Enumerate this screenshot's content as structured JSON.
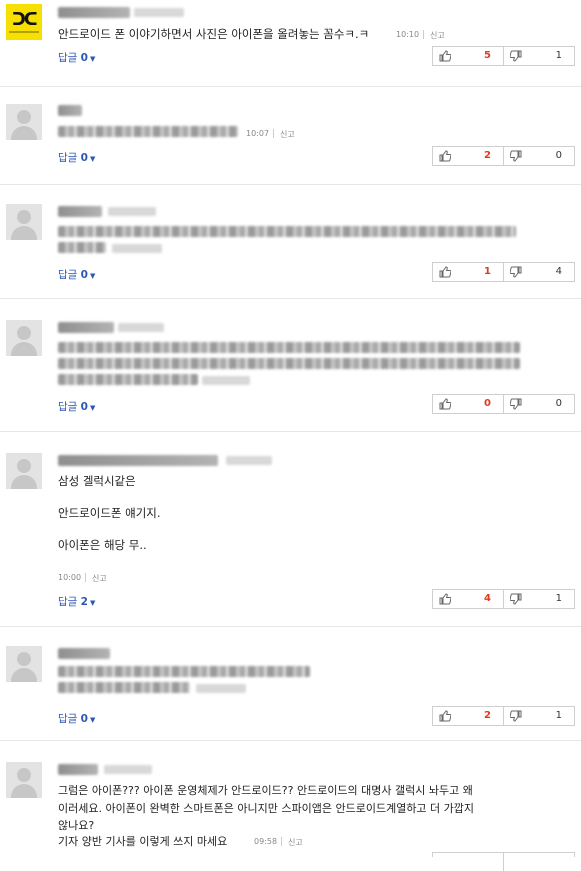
{
  "comments": [
    {
      "text_lines": [
        "안드로이드 폰 이야기하면서 사진은 아이폰을 올려놓는 꼼수ㅋ.ㅋ"
      ],
      "time": "10:10",
      "report_label": "신고",
      "reply_label": "답글",
      "reply_count": "0",
      "up_count": "5",
      "down_count": "1"
    },
    {
      "text_lines": [],
      "time": "10:07",
      "report_label": "신고",
      "reply_label": "답글",
      "reply_count": "0",
      "up_count": "2",
      "down_count": "0"
    },
    {
      "text_lines": [],
      "time": "",
      "report_label": "",
      "reply_label": "답글",
      "reply_count": "0",
      "up_count": "1",
      "down_count": "4"
    },
    {
      "text_lines": [],
      "time": "",
      "report_label": "",
      "reply_label": "답글",
      "reply_count": "0",
      "up_count": "0",
      "down_count": "0"
    },
    {
      "text_lines": [
        "삼성 겔럭시같은",
        "",
        "안드로이드폰 얘기지.",
        "",
        "아이폰은 해당 무.."
      ],
      "time": "10:00",
      "report_label": "신고",
      "reply_label": "답글",
      "reply_count": "2",
      "up_count": "4",
      "down_count": "1"
    },
    {
      "text_lines": [],
      "time": "",
      "report_label": "",
      "reply_label": "답글",
      "reply_count": "0",
      "up_count": "2",
      "down_count": "1"
    },
    {
      "text_lines": [
        "그럼은 아이폰??? 아이폰 운영체제가 안드로이드?? 안드로이드의 대명사 갤럭시 놔두고 왜",
        "이러세요. 아이폰이 완벽한 스마트폰은 아니지만 스파이앱은 안드로이드계열하고 더 가깝지",
        "않나요?",
        "기자 양반 기사를 이렇게 쓰지 마세요"
      ],
      "time": "09:58",
      "report_label": "신고"
    }
  ],
  "icons": {
    "upvote": "thumbs-up-icon",
    "downvote": "thumbs-down-icon",
    "reply_toggle": "caret-down-icon"
  },
  "colors": {
    "reply_link": "#2d57b6",
    "upvote_count": "#e13b1b",
    "logo_avatar": "#f7e000"
  }
}
